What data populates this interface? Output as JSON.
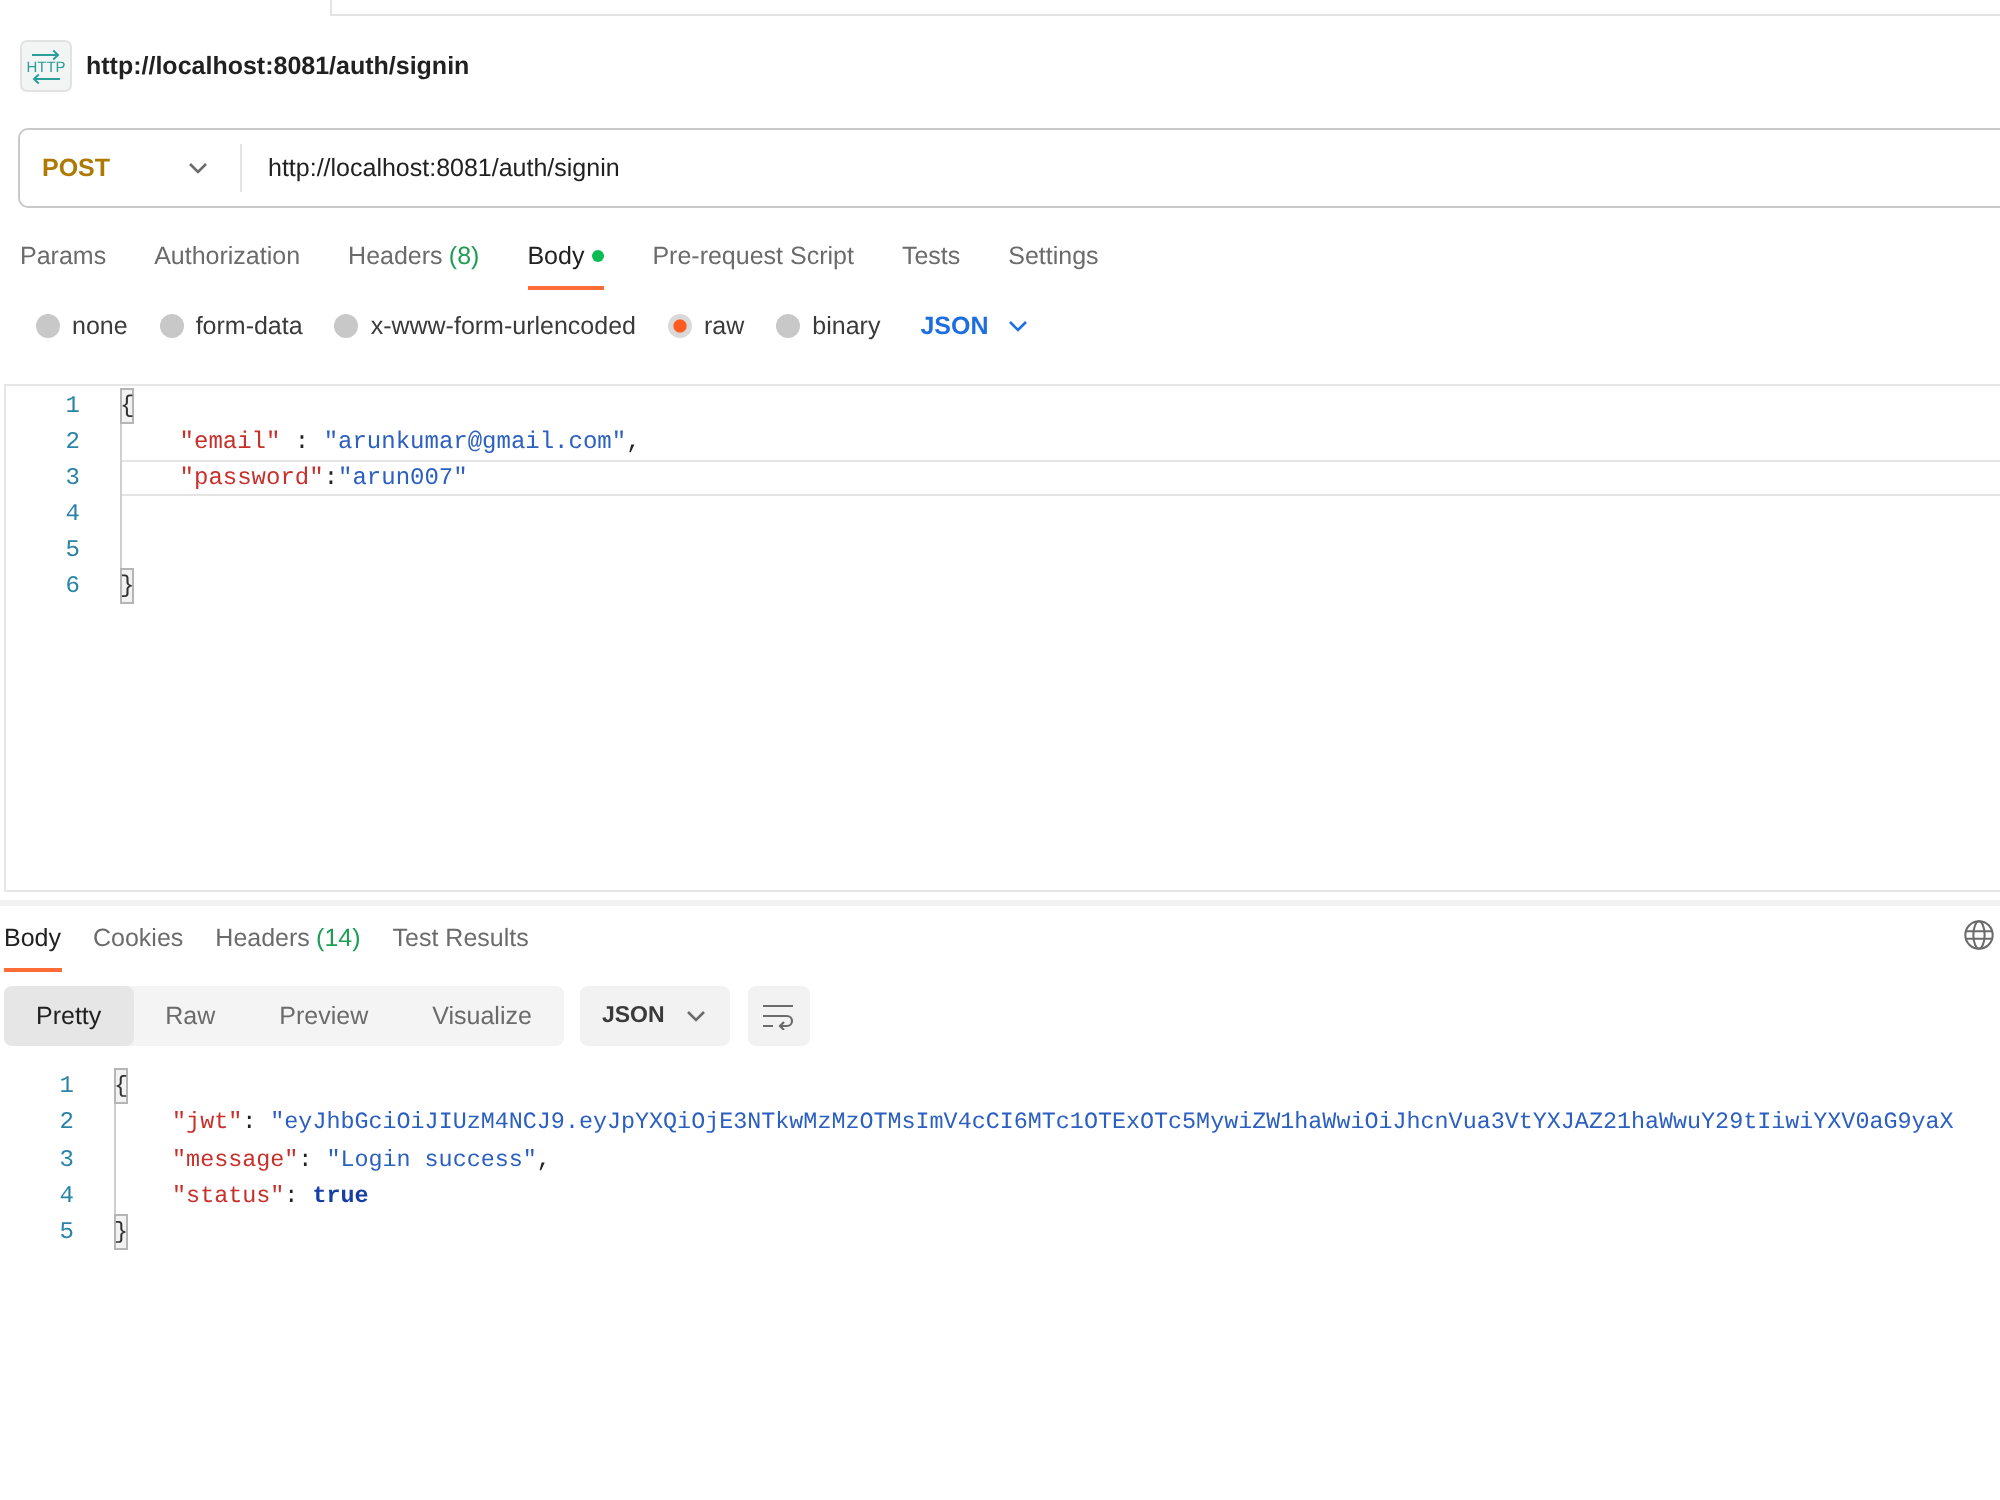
{
  "request": {
    "type_label": "HTTP",
    "title": "http://localhost:8081/auth/signin",
    "method": "POST",
    "url": "http://localhost:8081/auth/signin"
  },
  "request_tabs": [
    {
      "label": "Params",
      "selected": false,
      "indicator": false
    },
    {
      "label": "Authorization",
      "selected": false,
      "indicator": false
    },
    {
      "label": "Headers",
      "count": "(8)",
      "selected": false,
      "indicator": false
    },
    {
      "label": "Body",
      "selected": true,
      "indicator": true
    },
    {
      "label": "Pre-request Script",
      "selected": false,
      "indicator": false
    },
    {
      "label": "Tests",
      "selected": false,
      "indicator": false
    },
    {
      "label": "Settings",
      "selected": false,
      "indicator": false
    }
  ],
  "body_types": [
    {
      "label": "none",
      "selected": false
    },
    {
      "label": "form-data",
      "selected": false
    },
    {
      "label": "x-www-form-urlencoded",
      "selected": false
    },
    {
      "label": "raw",
      "selected": true
    },
    {
      "label": "binary",
      "selected": false
    }
  ],
  "body_format": "JSON",
  "request_body": {
    "lines": [
      {
        "number": "1",
        "current": false,
        "indented": false,
        "tokens": [
          {
            "kind": "bracket",
            "text": "{"
          }
        ]
      },
      {
        "number": "2",
        "current": false,
        "indented": true,
        "tokens": [
          {
            "kind": "key",
            "text": "\"email\""
          },
          {
            "kind": "punct",
            "text": " : "
          },
          {
            "kind": "string",
            "text": "\"arunkumar@gmail.com\""
          },
          {
            "kind": "punct",
            "text": ","
          }
        ]
      },
      {
        "number": "3",
        "current": true,
        "indented": true,
        "tokens": [
          {
            "kind": "key",
            "text": "\"password\""
          },
          {
            "kind": "punct",
            "text": ":"
          },
          {
            "kind": "string",
            "text": "\"arun007\""
          }
        ]
      },
      {
        "number": "4",
        "current": false
      },
      {
        "number": "5",
        "current": false
      },
      {
        "number": "6",
        "current": false,
        "indented": false,
        "tokens": [
          {
            "kind": "bracket",
            "text": "}"
          }
        ]
      }
    ]
  },
  "response_tabs": [
    {
      "label": "Body",
      "selected": true
    },
    {
      "label": "Cookies",
      "selected": false
    },
    {
      "label": "Headers",
      "count": "(14)",
      "selected": false
    },
    {
      "label": "Test Results",
      "selected": false
    }
  ],
  "view_modes": [
    {
      "label": "Pretty",
      "selected": true
    },
    {
      "label": "Raw",
      "selected": false
    },
    {
      "label": "Preview",
      "selected": false
    },
    {
      "label": "Visualize",
      "selected": false
    }
  ],
  "response_format": "JSON",
  "response_body": {
    "lines": [
      {
        "number": "1",
        "indented": false,
        "tokens": [
          {
            "kind": "bracket",
            "text": "{"
          }
        ]
      },
      {
        "number": "2",
        "indented": true,
        "tokens": [
          {
            "kind": "key",
            "text": "\"jwt\""
          },
          {
            "kind": "punct",
            "text": ": "
          },
          {
            "kind": "string",
            "text": "\"eyJhbGciOiJIUzM4NCJ9.eyJpYXQiOjE3NTkwMzMzOTMsImV4cCI6MTc1OTExOTc5MywiZW1haWwiOiJhcnVua3VtYXJAZ21haWwuY29tIiwiYXV0aG9yaX"
          }
        ]
      },
      {
        "number": "3",
        "indented": true,
        "tokens": [
          {
            "kind": "key",
            "text": "\"message\""
          },
          {
            "kind": "punct",
            "text": ": "
          },
          {
            "kind": "string",
            "text": "\"Login success\""
          },
          {
            "kind": "punct",
            "text": ","
          }
        ]
      },
      {
        "number": "4",
        "indented": true,
        "tokens": [
          {
            "kind": "key",
            "text": "\"status\""
          },
          {
            "kind": "punct",
            "text": ": "
          },
          {
            "kind": "bool",
            "text": "true"
          }
        ]
      },
      {
        "number": "5",
        "indented": false,
        "tokens": [
          {
            "kind": "bracket",
            "text": "}"
          }
        ]
      }
    ]
  }
}
